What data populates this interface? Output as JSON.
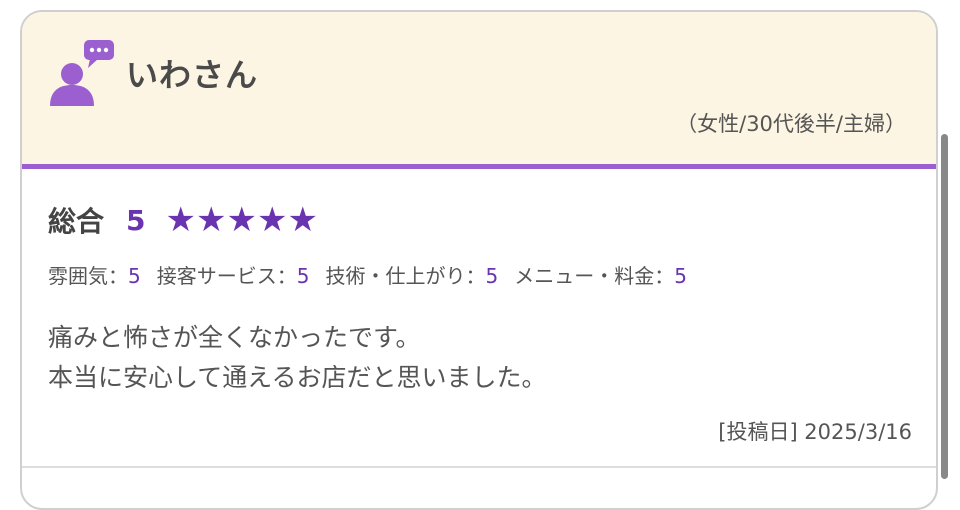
{
  "reviewer": {
    "name": "いわさん",
    "meta": "（女性/30代後半/主婦）",
    "avatar_icon": "user-comment-icon",
    "accent_color": "#9b5fcf"
  },
  "rating": {
    "overall_label": "総合",
    "overall_score": "5",
    "stars": 5,
    "star_color": "#6a34b0",
    "sub_ratings": [
      {
        "label": "雰囲気：",
        "value": "5"
      },
      {
        "label": "接客サービス：",
        "value": "5"
      },
      {
        "label": "技術・仕上がり：",
        "value": "5"
      },
      {
        "label": "メニュー・料金：",
        "value": "5"
      }
    ]
  },
  "comment": {
    "line1": "痛みと怖さが全くなかったです。",
    "line2": "本当に安心して通えるお店だと思いました。"
  },
  "post_date": "[投稿日] 2025/3/16",
  "header_bg": "#fcf5e3"
}
